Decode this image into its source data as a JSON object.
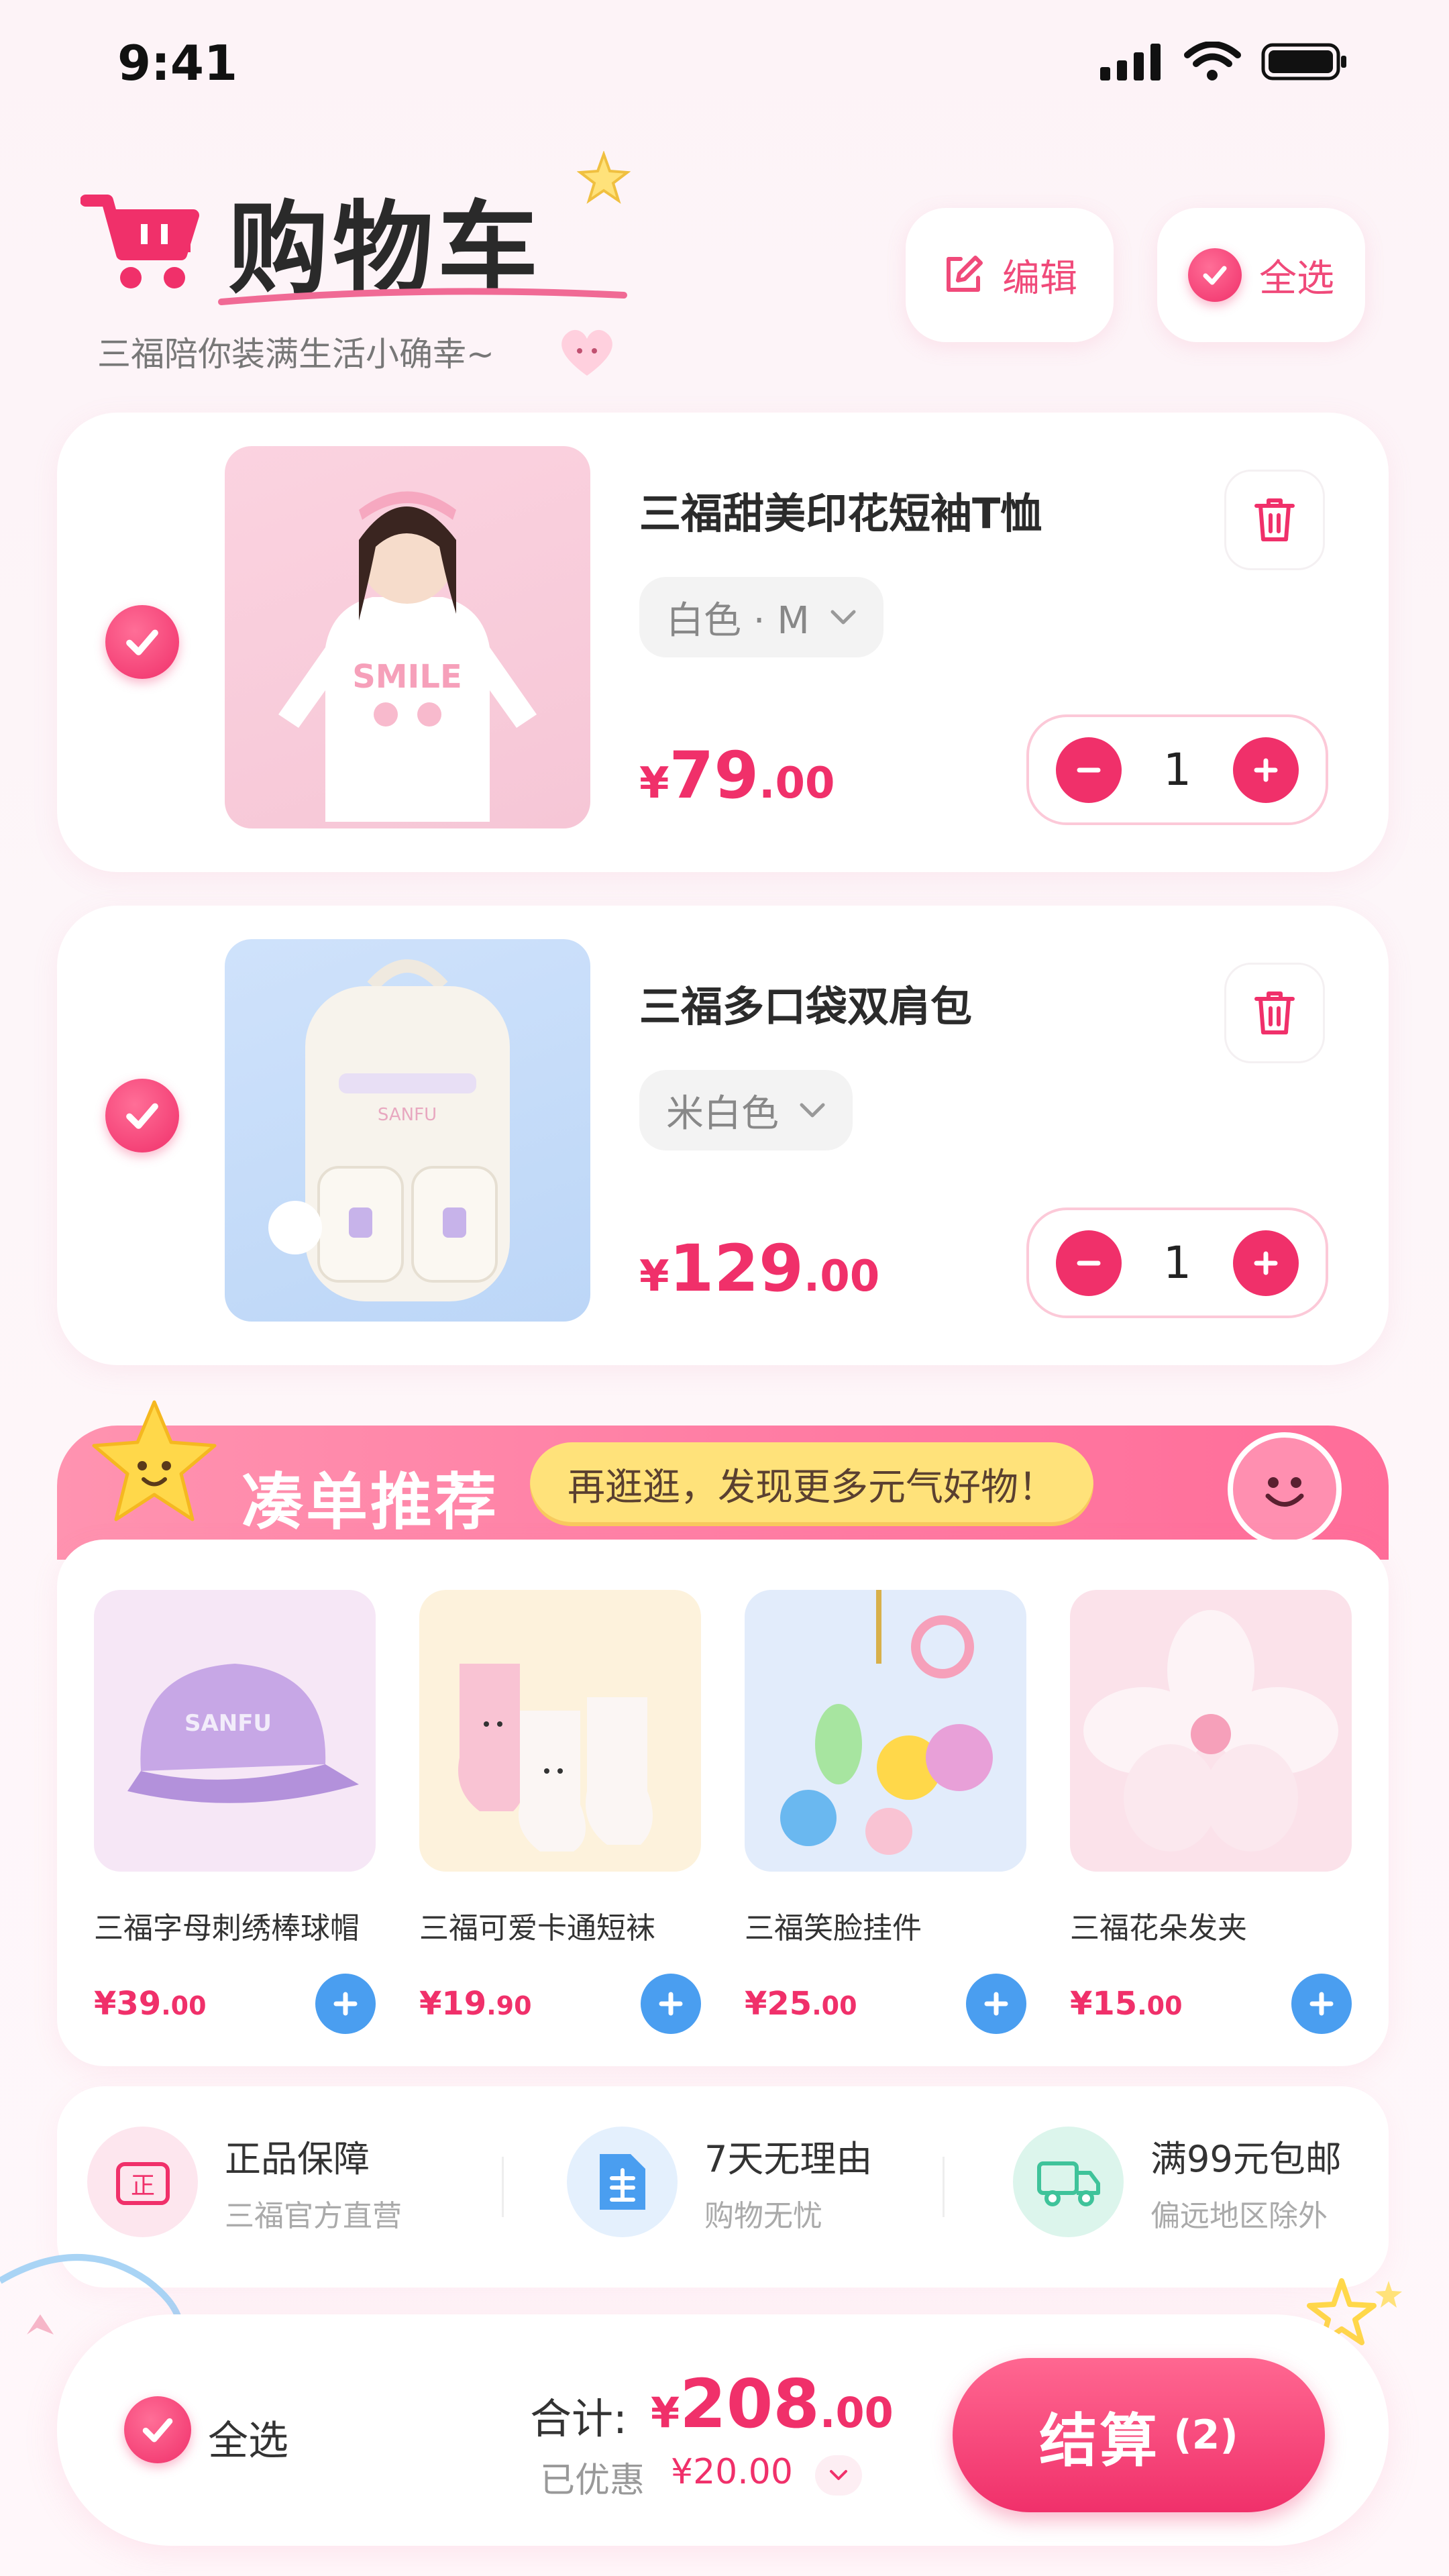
{
  "status_bar": {
    "time": "9:41"
  },
  "header": {
    "title": "购物车",
    "subtitle": "三福陪你装满生活小确幸~",
    "edit_label": "编辑",
    "select_all_label": "全选"
  },
  "cart": {
    "items": [
      {
        "name": "三福甜美印花短袖T恤",
        "variant": "白色 · M",
        "price_symbol": "¥",
        "price_int": "79",
        "price_dec": ".00",
        "quantity": "1",
        "checked": true
      },
      {
        "name": "三福多口袋双肩包",
        "variant": "米白色",
        "price_symbol": "¥",
        "price_int": "129",
        "price_dec": ".00",
        "quantity": "1",
        "checked": true
      }
    ]
  },
  "recommend": {
    "title": "凑单推荐",
    "tagline": "再逛逛，发现更多元气好物！",
    "items": [
      {
        "name": "三福字母刺绣棒球帽",
        "price_int": "¥39",
        "price_dec": ".00"
      },
      {
        "name": "三福可爱卡通短袜",
        "price_int": "¥19",
        "price_dec": ".90"
      },
      {
        "name": "三福笑脸挂件",
        "price_int": "¥25",
        "price_dec": ".00"
      },
      {
        "name": "三福花朵发夹",
        "price_int": "¥15",
        "price_dec": ".00"
      }
    ]
  },
  "guarantees": [
    {
      "title": "正品保障",
      "sub": "三福官方直营",
      "icon": "authentic-badge-icon",
      "color": "#f0306a"
    },
    {
      "title": "7天无理由",
      "sub": "购物无忧",
      "icon": "document-icon",
      "color": "#4a9ef0"
    },
    {
      "title": "满99元包邮",
      "sub": "偏远地区除外",
      "icon": "delivery-truck-icon",
      "color": "#3fc39a"
    }
  ],
  "bottom_bar": {
    "select_all_label": "全选",
    "total_label": "合计:",
    "total_symbol": "¥",
    "total_int": "208",
    "total_dec": ".00",
    "discount_label": "已优惠",
    "discount_amount": "¥20.00",
    "checkout_label": "结算",
    "checkout_count": "(2)"
  },
  "colors": {
    "accent": "#f0306a",
    "blue": "#4a9ef0",
    "yellow": "#ffe27a",
    "pink_light": "#fcc9d8"
  }
}
